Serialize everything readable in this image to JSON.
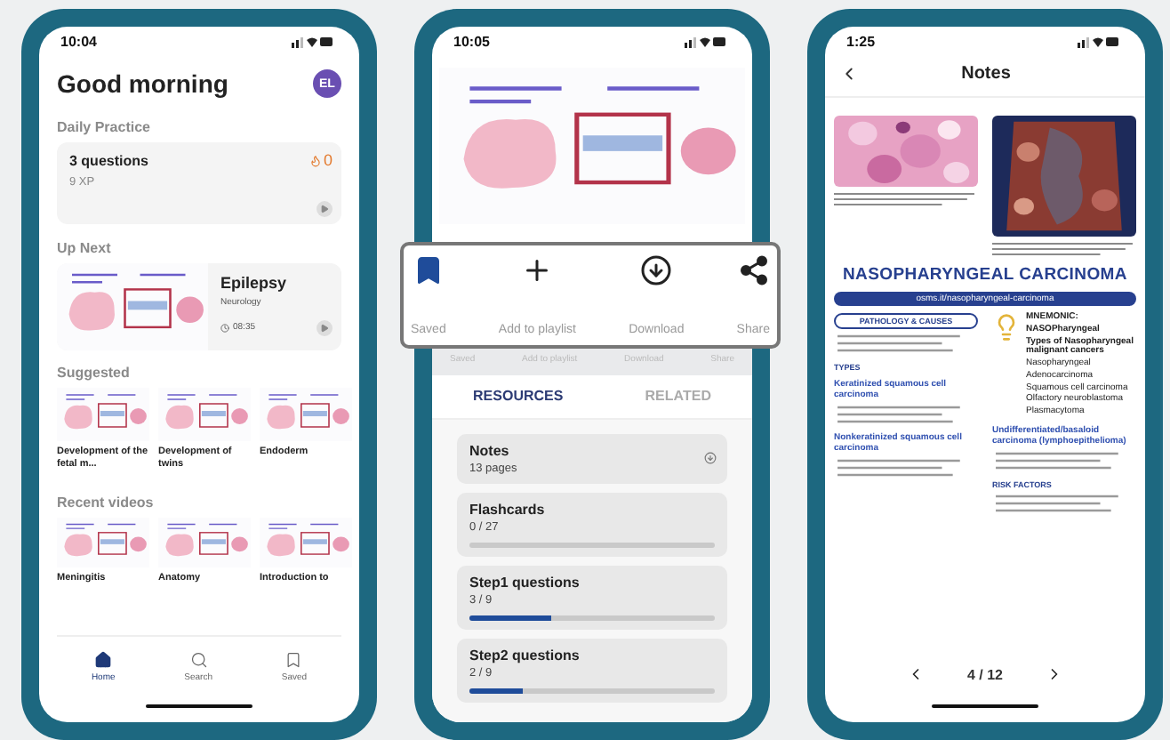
{
  "home_screen": {
    "time": "10:04",
    "greeting": "Good morning",
    "avatar": "EL",
    "daily": {
      "heading": "Daily Practice",
      "title": "3 questions",
      "xp": "9 XP",
      "streak": "0"
    },
    "up_next": {
      "heading": "Up Next",
      "title": "Epilepsy",
      "subject": "Neurology",
      "duration": "08:35"
    },
    "suggested": {
      "heading": "Suggested",
      "items": [
        "Development of the fetal m...",
        "Development of twins",
        "Endoderm"
      ]
    },
    "recent": {
      "heading": "Recent videos",
      "items": [
        "Meningitis",
        "Anatomy",
        "Introduction to"
      ]
    },
    "nav": [
      {
        "label": "Home",
        "selected": true
      },
      {
        "label": "Search",
        "selected": false
      },
      {
        "label": "Saved",
        "selected": false
      }
    ]
  },
  "video_screen": {
    "time": "10:05",
    "actions": [
      {
        "label": "Saved",
        "on": true
      },
      {
        "label": "Add to playlist",
        "on": false
      },
      {
        "label": "Download",
        "on": false
      },
      {
        "label": "Share",
        "on": false
      }
    ],
    "faded_actions": [
      "Saved",
      "Add to playlist",
      "Download",
      "Share"
    ],
    "tabs": [
      {
        "label": "RESOURCES",
        "selected": true
      },
      {
        "label": "RELATED",
        "selected": false
      }
    ],
    "resources": [
      {
        "kind": "download",
        "title": "Notes",
        "detail": "13 pages"
      },
      {
        "kind": "progress",
        "title": "Flashcards",
        "detail": "0 / 27",
        "level": 0
      },
      {
        "kind": "progress",
        "title": "Step1 questions",
        "detail": "3 / 9",
        "level": 0.33
      },
      {
        "kind": "progress",
        "title": "Step2 questions",
        "detail": "2 / 9",
        "level": 0.22
      }
    ]
  },
  "notes_screen": {
    "time": "1:25",
    "title": "Notes",
    "doc_title": "NASOPHARYNGEAL CARCINOMA",
    "doc_link": "osms.it/nasopharyngeal-carcinoma",
    "left_column": [
      {
        "kind": "pill",
        "text": "PATHOLOGY & CAUSES"
      },
      {
        "kind": "fine_print"
      },
      {
        "kind": "heading",
        "text": "TYPES"
      },
      {
        "kind": "subheading",
        "text": "Keratinized squamous cell carcinoma"
      },
      {
        "kind": "fine_print"
      },
      {
        "kind": "subheading",
        "text": "Nonkeratinized squamous cell carcinoma"
      },
      {
        "kind": "fine_print"
      }
    ],
    "right_column": [
      {
        "kind": "mnemonic",
        "title": "MNEMONIC:",
        "word": "NASOPharyngeal",
        "caption": "Types of Nasopharyngeal malignant cancers",
        "items": [
          "Nasopharyngeal",
          "Adenocarcinoma",
          "Squamous cell carcinoma",
          "Olfactory neuroblastoma",
          "Plasmacytoma"
        ]
      },
      {
        "kind": "subheading",
        "text": "Undifferentiated/basaloid carcinoma (lymphoepithelioma)"
      },
      {
        "kind": "fine_print"
      },
      {
        "kind": "heading",
        "text": "RISK FACTORS"
      },
      {
        "kind": "fine_print"
      }
    ],
    "page": "4 / 12"
  }
}
